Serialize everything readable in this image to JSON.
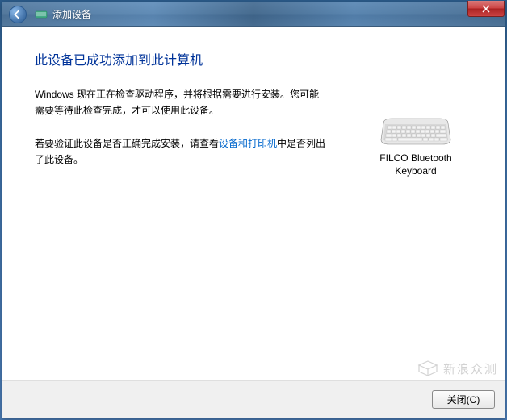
{
  "titlebar": {
    "title": "添加设备"
  },
  "heading": "此设备已成功添加到此计算机",
  "paragraph1_a": "Windows 现在正在检查驱动程序，并将根据需要进行安装。您可能需要等待此检查完成，才可以使用此设备。",
  "paragraph2_pre": "若要验证此设备是否正确完成安装，请查看",
  "paragraph2_link": "设备和打印机",
  "paragraph2_post": "中是否列出了此设备。",
  "device": {
    "name_line1": "FILCO Bluetooth",
    "name_line2": "Keyboard"
  },
  "footer": {
    "close_label": "关闭(C)"
  },
  "watermark": "新浪众测"
}
